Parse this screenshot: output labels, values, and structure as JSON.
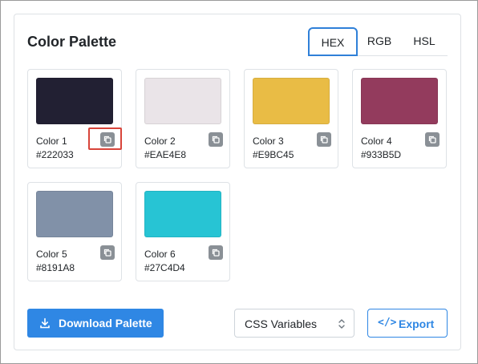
{
  "header": {
    "title": "Color Palette"
  },
  "tabs": [
    {
      "label": "HEX",
      "active": true
    },
    {
      "label": "RGB",
      "active": false
    },
    {
      "label": "HSL",
      "active": false
    }
  ],
  "colors": [
    {
      "name": "Color 1",
      "hex": "#222033"
    },
    {
      "name": "Color 2",
      "hex": "#EAE4E8"
    },
    {
      "name": "Color 3",
      "hex": "#E9BC45"
    },
    {
      "name": "Color 4",
      "hex": "#933B5D"
    },
    {
      "name": "Color 5",
      "hex": "#8191A8"
    },
    {
      "name": "Color 6",
      "hex": "#27C4D4"
    }
  ],
  "actions": {
    "download_label": "Download Palette",
    "format_select": {
      "value": "CSS Variables"
    },
    "export_label": "Export",
    "export_icon_glyph": "</>"
  },
  "theme": {
    "accent": "#2f87e4",
    "highlight": "#d8443a"
  },
  "icons": [
    "copy-icon",
    "download-icon",
    "code-icon",
    "chevron-up-down-icon"
  ]
}
